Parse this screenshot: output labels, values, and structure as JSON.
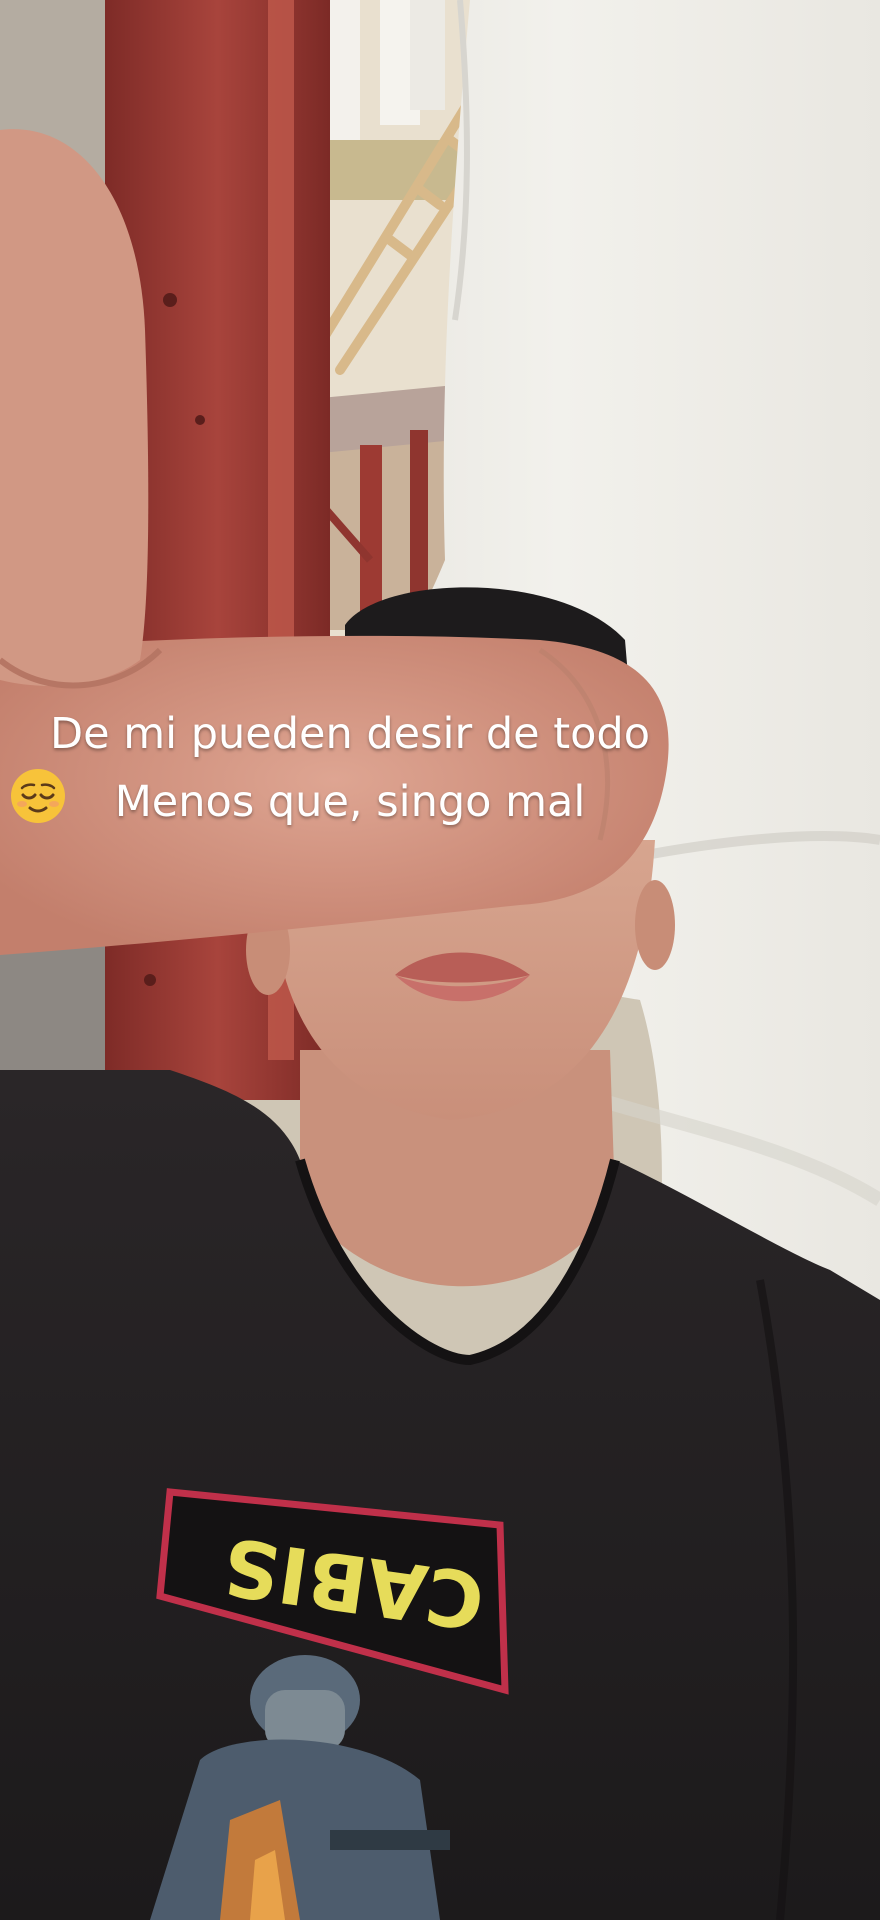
{
  "caption": {
    "line1": "De mi pueden desir de todo",
    "line2": "Menos que, singo mal",
    "emoji": "relieved-face"
  },
  "shirt_print": {
    "text": "CABIS"
  },
  "colors": {
    "wall": "#ecebe6",
    "pillar": "#9b3a34",
    "skin": "#d29a84",
    "shirt": "#232021",
    "print_red": "#c0304a",
    "print_yellow": "#e6dc5a"
  }
}
